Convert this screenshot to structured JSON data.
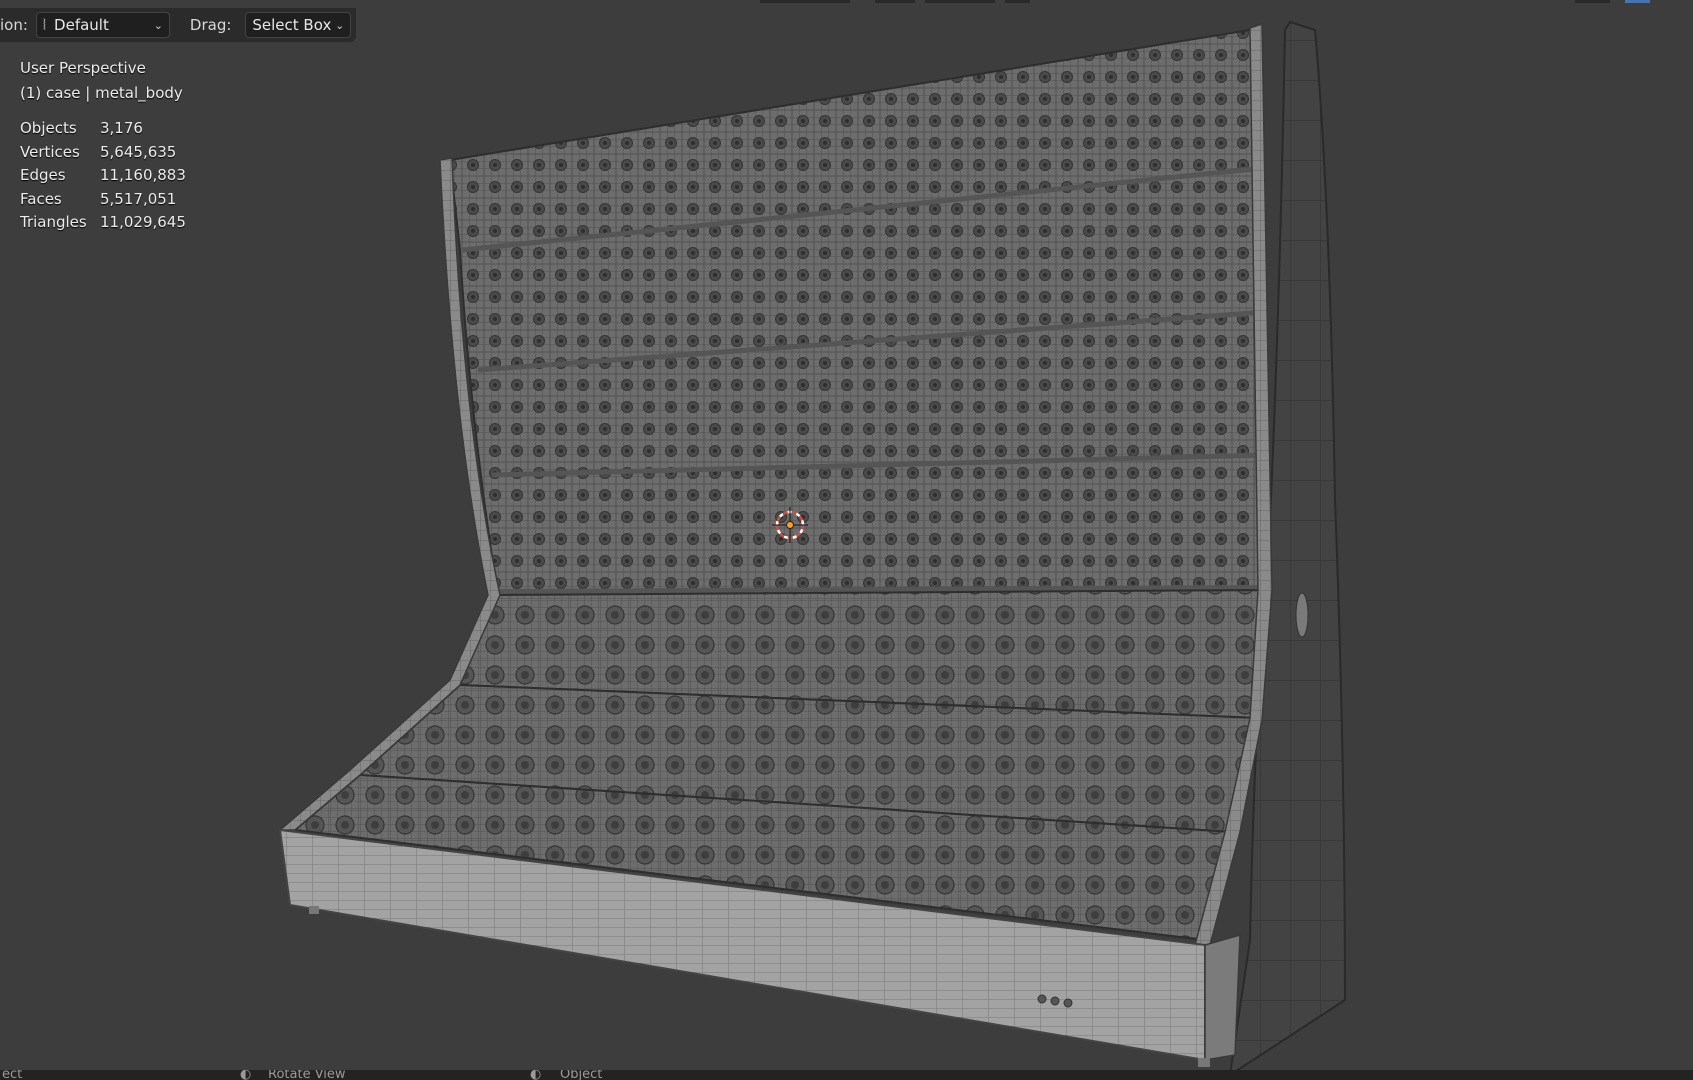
{
  "header": {
    "orientation_label": "ion:",
    "orientation_value": "Default",
    "drag_label": "Drag:",
    "drag_value": "Select Box"
  },
  "overlay": {
    "view_name": "User Perspective",
    "object_info": "(1) case | metal_body"
  },
  "stats": [
    {
      "label": "Objects",
      "value": "3,176"
    },
    {
      "label": "Vertices",
      "value": "5,645,635"
    },
    {
      "label": "Edges",
      "value": "11,160,883"
    },
    {
      "label": "Faces",
      "value": "5,517,051"
    },
    {
      "label": "Triangles",
      "value": "11,029,645"
    }
  ],
  "status_bar": {
    "left": "ect",
    "middle": "Rotate View",
    "right": "Object"
  },
  "colors": {
    "viewport_bg": "#3d3d3d",
    "header_bg": "#2b2b2b",
    "mesh_fill": "#6e6e6e",
    "wire": "#2f2f2f",
    "cursor_red": "#d94a3a",
    "origin_orange": "#ff9c22"
  },
  "icons": {
    "orientation": "transform-orientation-icon",
    "chevron": "chevron-down-icon",
    "cursor": "3d-cursor-icon"
  }
}
